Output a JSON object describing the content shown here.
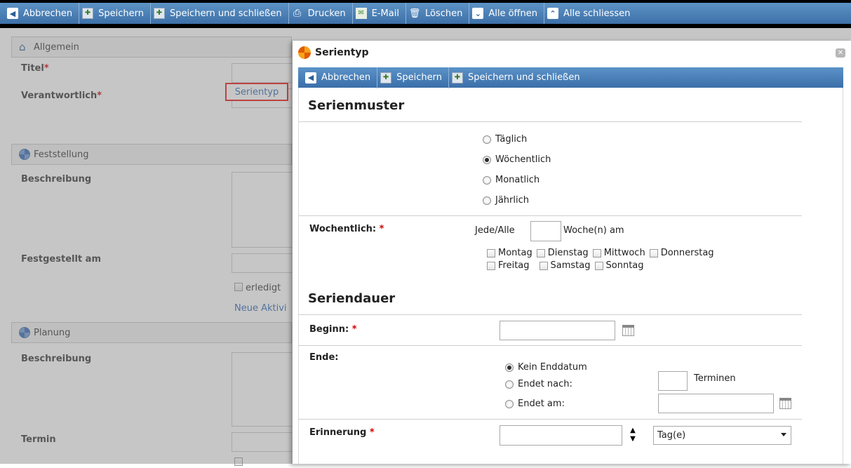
{
  "main_toolbar": {
    "buttons": [
      {
        "label": "Abbrechen"
      },
      {
        "label": "Speichern"
      },
      {
        "label": "Speichern und schließen"
      },
      {
        "label": "Drucken"
      },
      {
        "label": "E-Mail"
      },
      {
        "label": "Löschen"
      },
      {
        "label": "Alle öffnen"
      },
      {
        "label": "Alle schliessen"
      }
    ]
  },
  "form": {
    "sections": {
      "allgemein": "Allgemein",
      "feststellung": "Feststellung",
      "planung": "Planung"
    },
    "labels": {
      "titel": "Titel",
      "verantwortlich": "Verantwortlich",
      "beschreibung1": "Beschreibung",
      "festgestellt_am": "Festgestellt am",
      "beschreibung2": "Beschreibung",
      "termin": "Termin"
    },
    "required_mark": "*",
    "serientyp_button": "Serientyp",
    "erledigt_label": "erledigt",
    "neue_aktivitaet_link": "Neue Aktivi"
  },
  "dialog": {
    "title": "Serientyp",
    "toolbar": {
      "cancel": "Abbrechen",
      "save": "Speichern",
      "save_close": "Speichern und schließen"
    },
    "serienmuster": {
      "heading": "Serienmuster",
      "options": [
        {
          "label": "Täglich",
          "selected": false
        },
        {
          "label": "Wöchentlich",
          "selected": true
        },
        {
          "label": "Monatlich",
          "selected": false
        },
        {
          "label": "Jährlich",
          "selected": false
        }
      ]
    },
    "woechentlich": {
      "label": "Wochentlich:",
      "required": "*",
      "jede_alle": "Jede/Alle",
      "interval_value": "",
      "woche_am": "Woche(n) am",
      "days_row1": [
        "Montag",
        "Dienstag",
        "Mittwoch",
        "Donnerstag"
      ],
      "days_row2": [
        "Freitag",
        "Samstag",
        "Sonntag"
      ]
    },
    "seriendauer": {
      "heading": "Seriendauer",
      "beginn_label": "Beginn:",
      "beginn_value": "",
      "ende_label": "Ende:",
      "ende_options": [
        {
          "label": "Kein Enddatum",
          "selected": true
        },
        {
          "label": "Endet nach:",
          "selected": false
        },
        {
          "label": "Endet am:",
          "selected": false
        }
      ],
      "termine_value": "",
      "termine_label": "Terminen",
      "endet_am_value": ""
    },
    "erinnerung": {
      "label": "Erinnerung",
      "required": "*",
      "value": "",
      "unit_selected": "Tag(e)"
    }
  }
}
